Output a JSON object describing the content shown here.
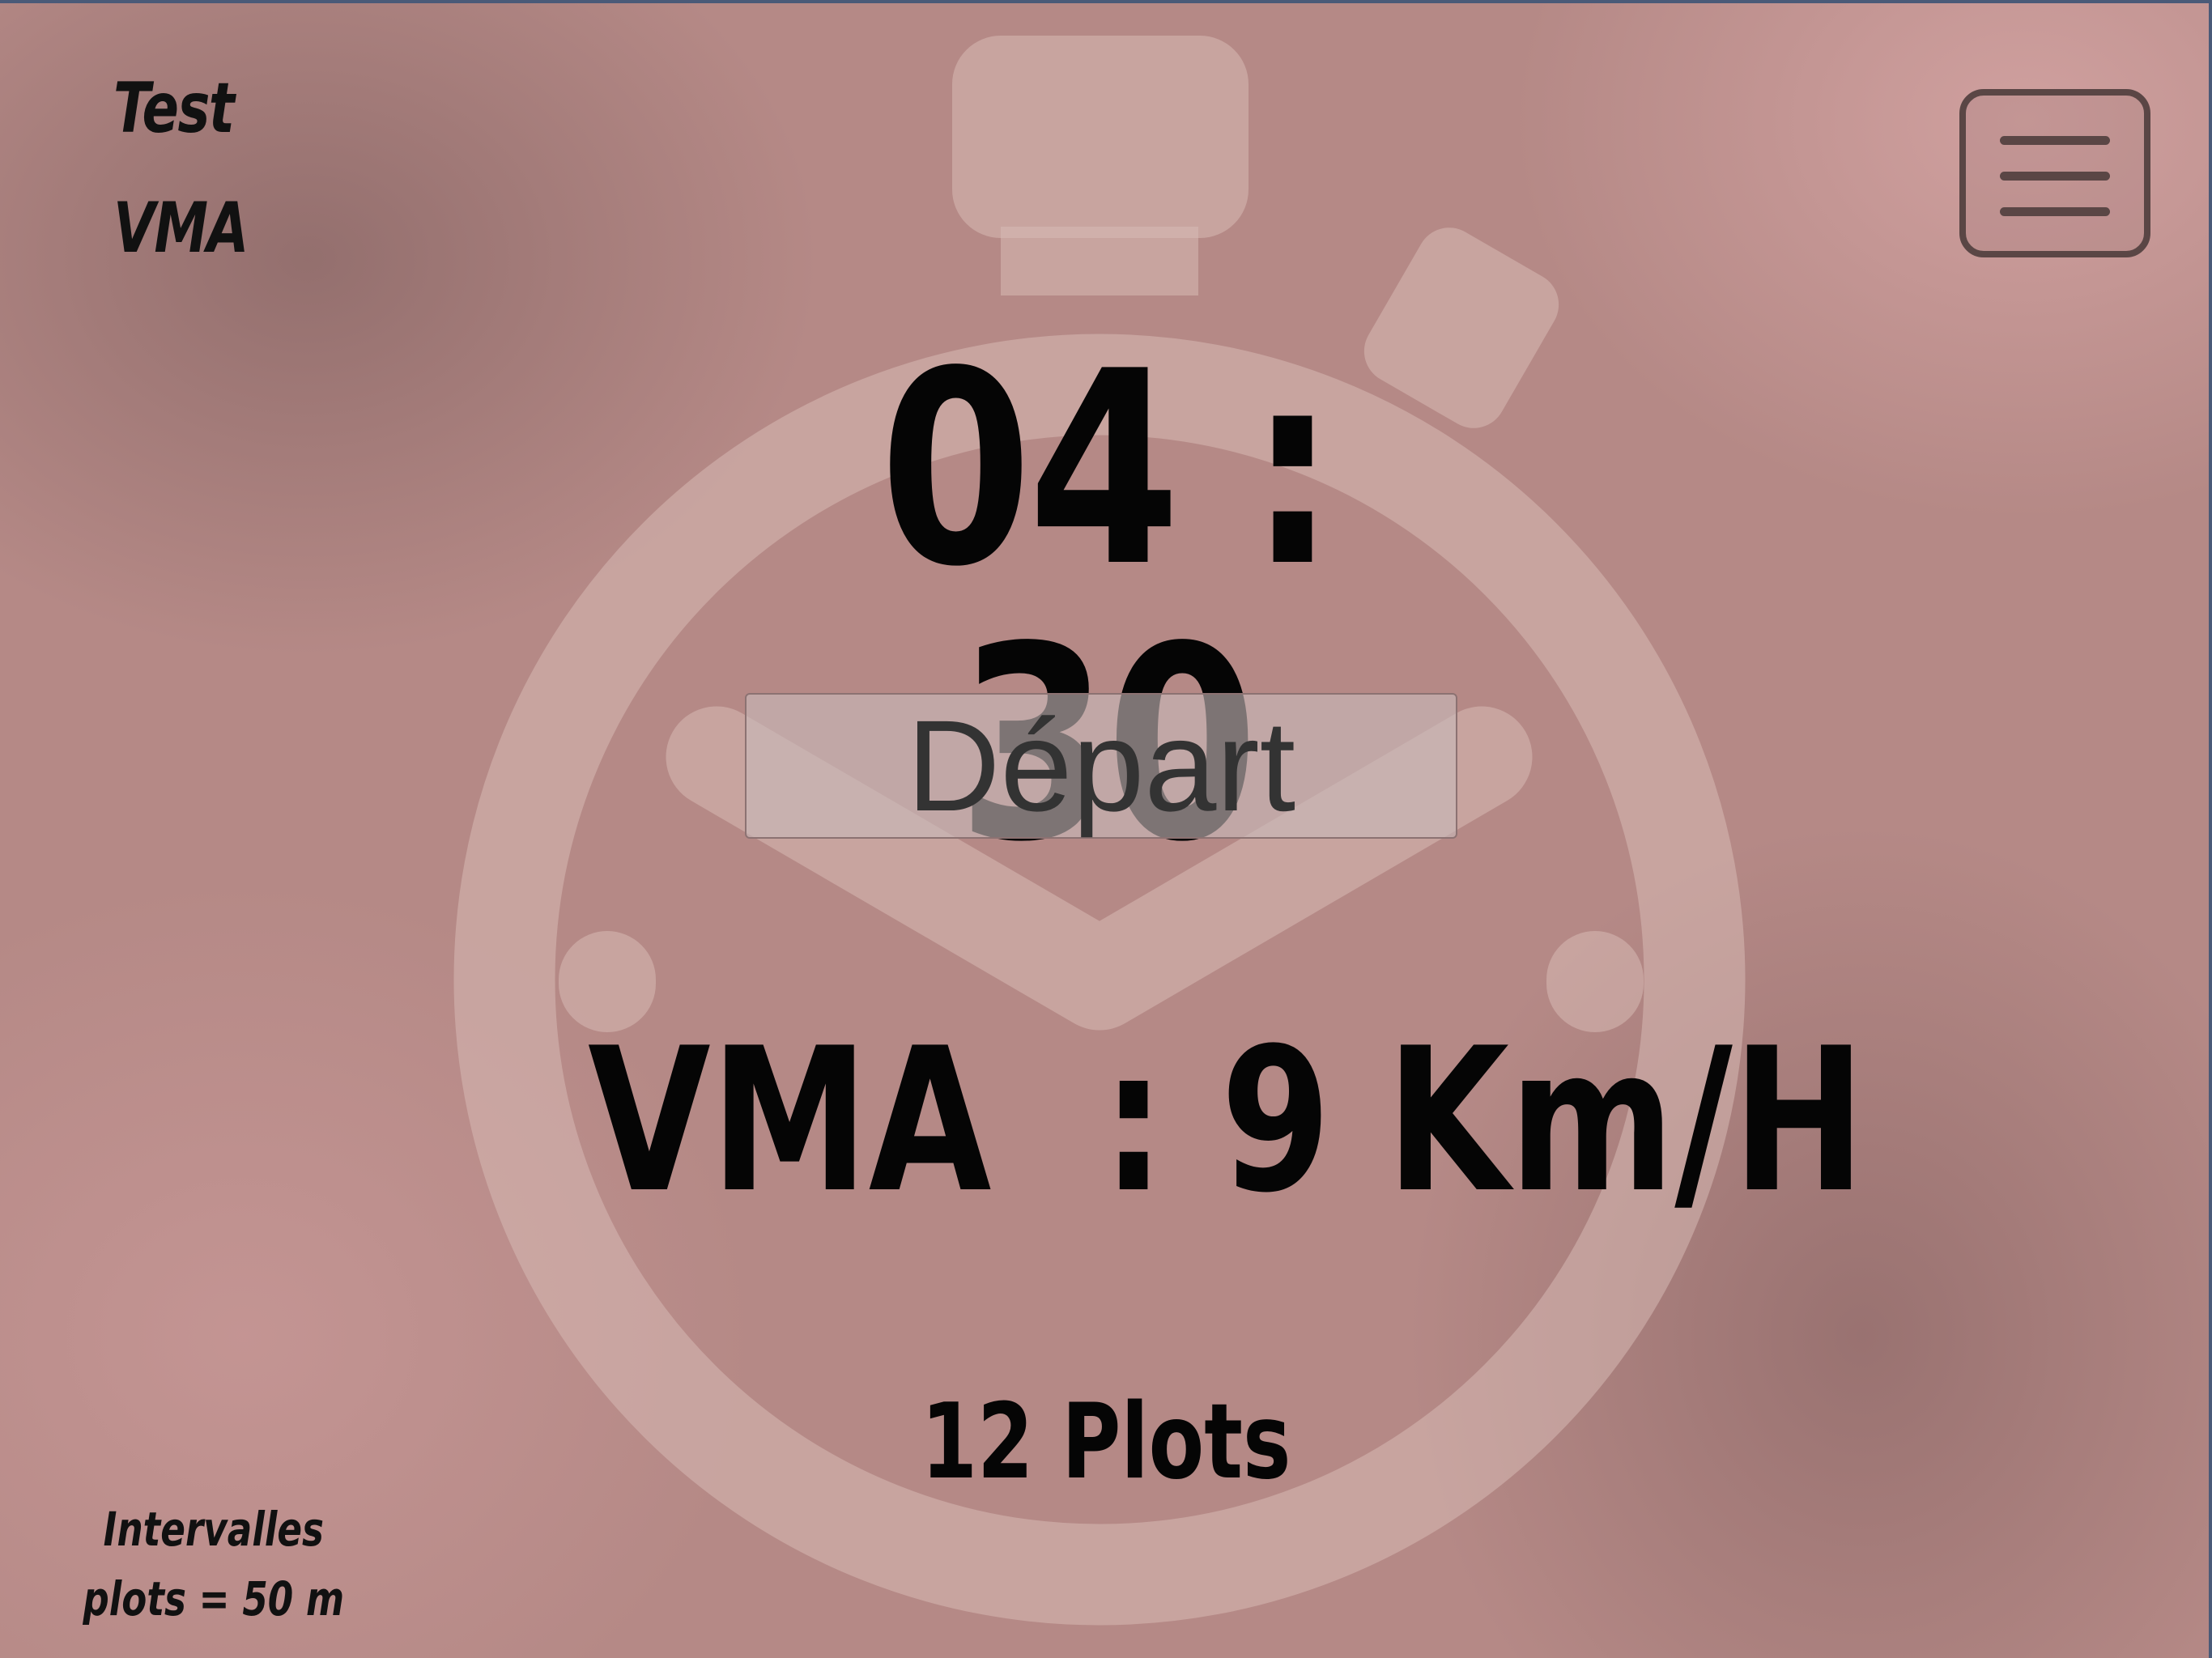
{
  "app": {
    "title_line1": "Test",
    "title_line2": "VMA"
  },
  "menu": {
    "icon": "hamburger-menu-icon"
  },
  "background": {
    "icon": "stopwatch-icon"
  },
  "timer": {
    "display": "04 : 30"
  },
  "controls": {
    "start_label": "Départ"
  },
  "result": {
    "vma_text": "VMA  : 9 Km/H",
    "plots_text": "12 Plots"
  },
  "footer": {
    "line1": "Intervalles",
    "line2": "plots = 50 m"
  },
  "colors": {
    "background": "#b58986",
    "text": "#050505",
    "menu_border": "#5a4645",
    "button_text": "#333333"
  }
}
